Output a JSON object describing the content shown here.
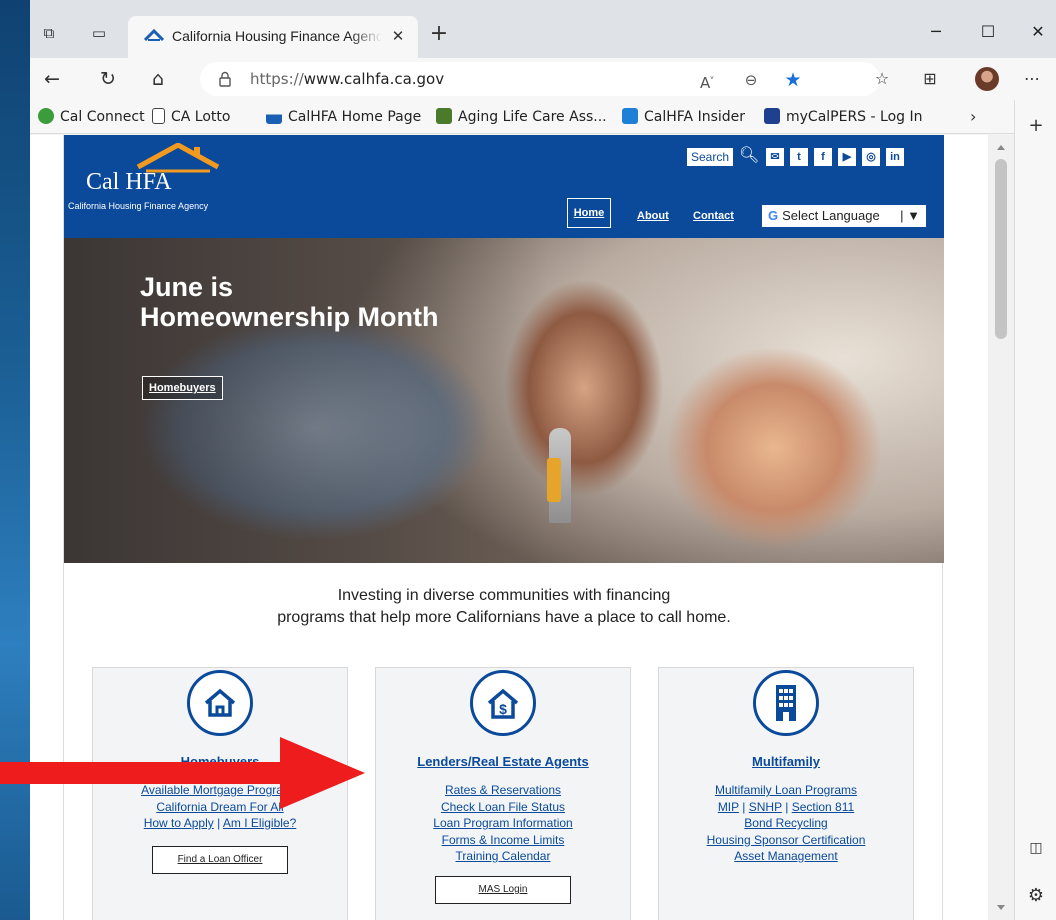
{
  "browser": {
    "tab_title": "California Housing Finance Agency",
    "url_protocol": "https://",
    "url_host": "www.calhfa.ca.gov",
    "reader_label": "A͆",
    "window_controls": [
      "minimize",
      "maximize",
      "close"
    ]
  },
  "bookmarks": [
    {
      "label": "Cal Connect",
      "icon": "cal-connect-icon",
      "color": "#3a9c3a"
    },
    {
      "label": "CA Lotto",
      "icon": "page-icon",
      "color": "#ffffff"
    },
    {
      "label": "CalHFA Home Page",
      "icon": "calhfa-icon",
      "color": "#1a5fb4"
    },
    {
      "label": "Aging Life Care Ass...",
      "icon": "aging-life-icon",
      "color": "#4a7a2a"
    },
    {
      "label": "CalHFA Insider",
      "icon": "insider-icon",
      "color": "#1e7fd6"
    },
    {
      "label": "myCalPERS - Log In",
      "icon": "mycalpers-icon",
      "color": "#1f3f8f"
    }
  ],
  "site": {
    "logo_name": "Cal HFA",
    "logo_tagline": "California Housing Finance Agency",
    "search_label": "Search",
    "nav": {
      "home": "Home",
      "about": "About",
      "contact": "Contact"
    },
    "translate_label": "Select Language",
    "social": [
      "✉",
      "t",
      "f",
      "▶",
      "◎",
      "in"
    ],
    "accent": "#0b4a9a"
  },
  "hero": {
    "title": "June is Homeownership Month",
    "cta": "Homebuyers"
  },
  "mission": {
    "line1": "Investing in diverse communities with financing",
    "line2": "programs that help more Californians have a place to call home."
  },
  "cards": {
    "homebuyers": {
      "title": "Homebuyers",
      "links": [
        "Available Mortgage Programs",
        "California Dream For All",
        "How to Apply",
        "Am I Eligible?"
      ],
      "button": "Find a Loan Officer"
    },
    "lenders": {
      "title": "Lenders/Real Estate Agents",
      "links": [
        "Rates & Reservations",
        "Check Loan File Status",
        "Loan Program Information",
        "Forms & Income Limits",
        "Training Calendar"
      ],
      "button": "MAS Login"
    },
    "multifamily": {
      "title": "Multifamily",
      "links": [
        "Multifamily Loan Programs",
        "MIP",
        "SNHP",
        "Section 811",
        "Bond Recycling",
        "Housing Sponsor Certification",
        "Asset Management"
      ]
    }
  }
}
